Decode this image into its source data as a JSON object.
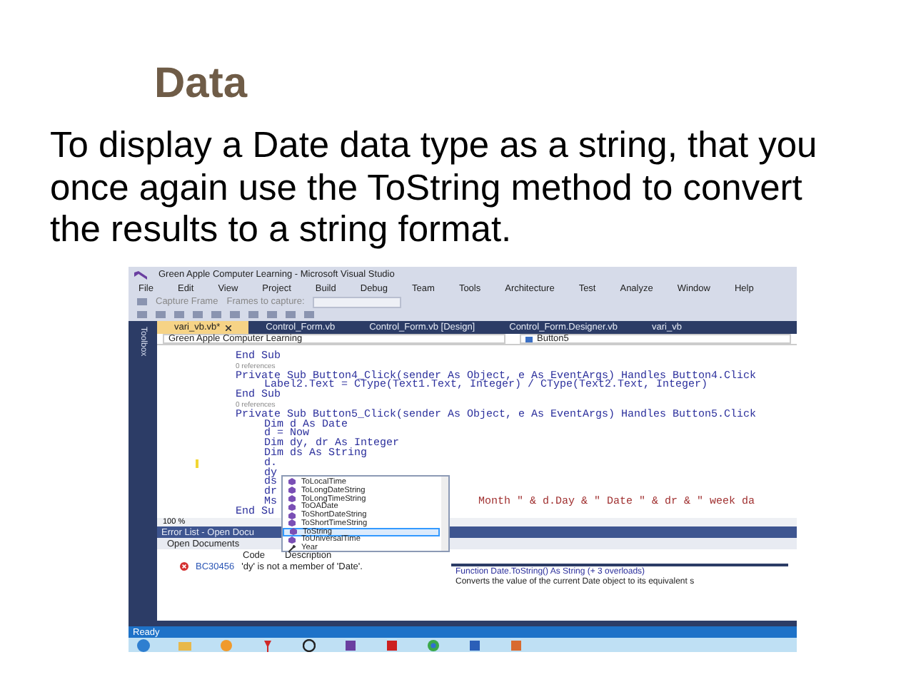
{
  "slide": {
    "title": "Data",
    "body": "To display a Date data type as a string, that you once again use the ToString method to convert the results to a string format."
  },
  "ide": {
    "title": "Green Apple Computer Learning - Microsoft Visual Studio",
    "menu": [
      "File",
      "Edit",
      "View",
      "Project",
      "Build",
      "Debug",
      "Team",
      "Tools",
      "Architecture",
      "Test",
      "Analyze",
      "Window",
      "Help"
    ],
    "toolbar": [
      "Capture Frame",
      "Frames to capture:"
    ],
    "sidebar_label": "Toolbox",
    "tabs": [
      {
        "label": "vari_vb.vb*",
        "selected": true
      },
      {
        "label": "Control_Form.vb",
        "selected": false
      },
      {
        "label": "Control_Form.vb [Design]",
        "selected": false
      },
      {
        "label": "Control_Form.Designer.vb",
        "selected": false
      },
      {
        "label": "vari_vb",
        "selected": false
      }
    ],
    "nav": {
      "project": "Green Apple Computer Learning",
      "member": "Button5"
    },
    "code_lines": [
      {
        "kind": "code",
        "text": "End Sub"
      },
      {
        "kind": "refs",
        "text": "0 references"
      },
      {
        "kind": "code",
        "text": "Private Sub Button4_Click(sender As Object, e As EventArgs) Handles Button4.Click",
        "children": [
          {
            "kind": "code",
            "text": "Label2.Text = CType(Text1.Text, Integer) / CType(Text2.Text, Integer)"
          }
        ]
      },
      {
        "kind": "code",
        "text": "End Sub"
      },
      {
        "kind": "refs",
        "text": "0 references"
      },
      {
        "kind": "code",
        "text": "Private Sub Button5_Click(sender As Object, e As EventArgs) Handles Button5.Click",
        "children": [
          {
            "kind": "code",
            "text": "Dim d As Date"
          },
          {
            "kind": "code",
            "text": "d = Now"
          },
          {
            "kind": "code",
            "text": "Dim dy, dr As Integer"
          },
          {
            "kind": "code",
            "text": "Dim ds As String"
          },
          {
            "kind": "code",
            "text": "d.",
            "changed": true
          },
          {
            "kind": "code",
            "text": "dy"
          },
          {
            "kind": "code",
            "text": "ds"
          },
          {
            "kind": "code",
            "text": "dr"
          },
          {
            "kind": "code",
            "text": "Ms",
            "trailing": "Month \" & d.Day & \" Date \" & dr & \" week da"
          }
        ]
      },
      {
        "kind": "code",
        "text": "End Su"
      }
    ],
    "zoom": "100 %",
    "completion": [
      {
        "label": "ToLocalTime",
        "kind": "method",
        "selected": false
      },
      {
        "label": "ToLongDateString",
        "kind": "method",
        "selected": false
      },
      {
        "label": "ToLongTimeString",
        "kind": "method",
        "selected": false
      },
      {
        "label": "ToOADate",
        "kind": "method",
        "selected": false
      },
      {
        "label": "ToShortDateString",
        "kind": "method",
        "selected": false
      },
      {
        "label": "ToShortTimeString",
        "kind": "method",
        "selected": false
      },
      {
        "label": "ToString",
        "kind": "method",
        "selected": true
      },
      {
        "label": "ToUniversalTime",
        "kind": "method",
        "selected": false
      },
      {
        "label": "Year",
        "kind": "property",
        "selected": false
      }
    ],
    "tooltip": {
      "signature": "Function Date.ToString() As String (+ 3 overloads)",
      "description": "Converts the value of the current Date object to its equivalent s"
    },
    "error_list": {
      "title": "Error List - Open Docu",
      "scope": "Open Documents",
      "columns": [
        "Code",
        "Description"
      ],
      "rows": [
        {
          "code": "BC30456",
          "description": "'dy' is not a member of 'Date'."
        }
      ]
    },
    "status": "Ready"
  }
}
